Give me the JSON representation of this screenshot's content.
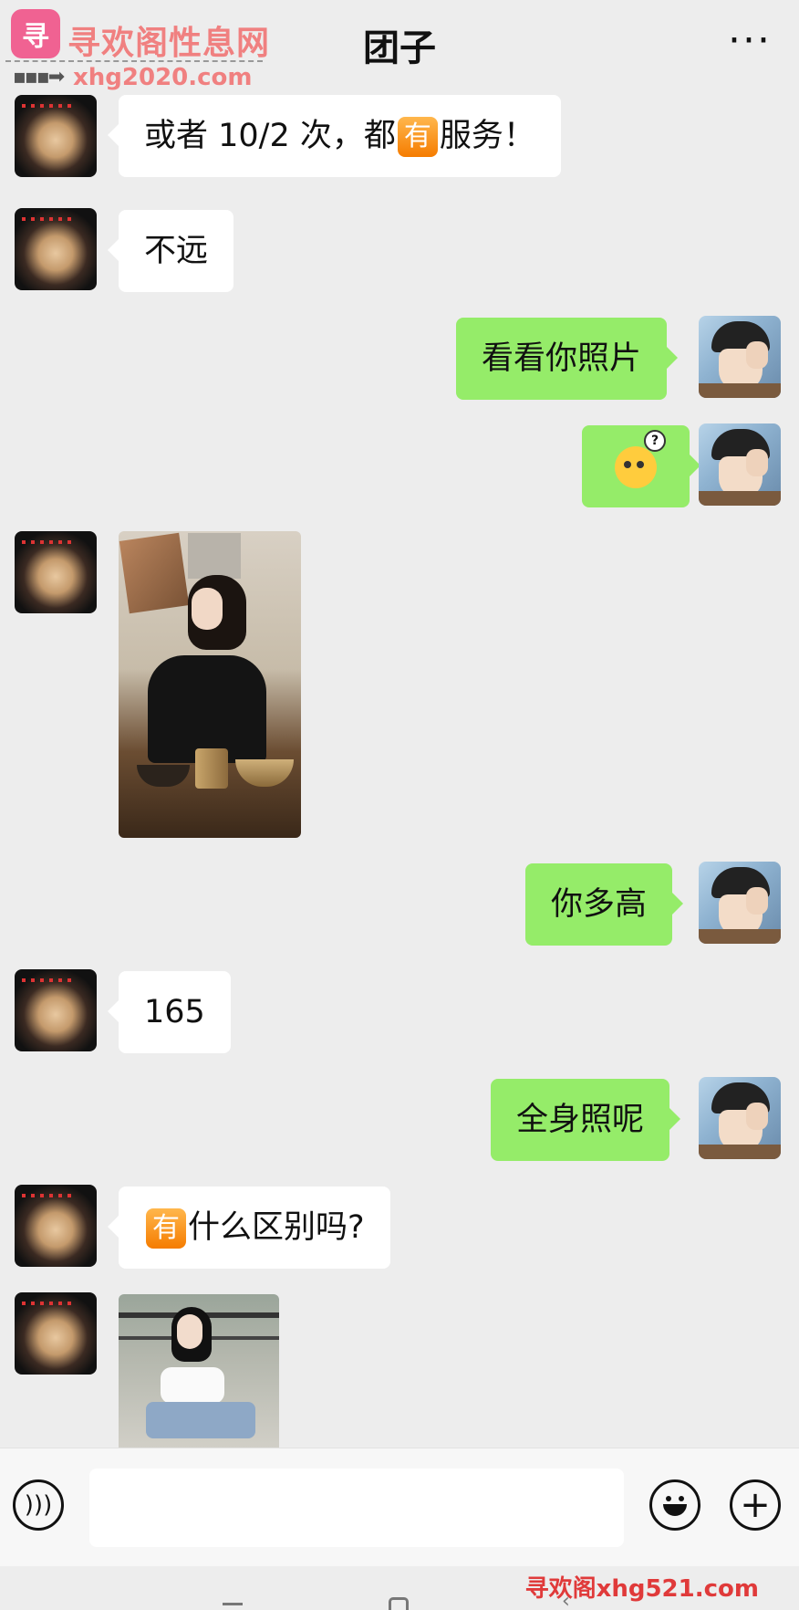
{
  "header": {
    "title": "团子",
    "back_glyph": "‹",
    "more_glyph": "···"
  },
  "watermark": {
    "logo_char": "寻",
    "site_name": "寻欢阁性息网",
    "site_url": "xhg2020.com",
    "arrow": "▪▪▪➡",
    "bottom": "寻欢阁xhg521.com"
  },
  "messages": [
    {
      "side": "left",
      "type": "text",
      "parts": [
        "或者 10/2 次，都",
        "有",
        "服务！"
      ]
    },
    {
      "side": "left",
      "type": "text",
      "text": "不远"
    },
    {
      "side": "right",
      "type": "text",
      "text": "看看你照片"
    },
    {
      "side": "right",
      "type": "emoji",
      "icon": "confused-face-emoji"
    },
    {
      "side": "left",
      "type": "image",
      "desc": "photo-woman-black-top"
    },
    {
      "side": "right",
      "type": "text",
      "text": "你多高"
    },
    {
      "side": "left",
      "type": "text",
      "text": "165"
    },
    {
      "side": "right",
      "type": "text",
      "text": "全身照呢"
    },
    {
      "side": "left",
      "type": "text",
      "parts": [
        "有",
        "什么区别吗?"
      ]
    },
    {
      "side": "left",
      "type": "image",
      "desc": "photo-woman-white-top"
    }
  ],
  "input": {
    "value": "",
    "voice_icon": "voice-icon",
    "emoji_icon": "emoji-icon",
    "plus_icon": "plus-icon",
    "plus_glyph": "+"
  },
  "colors": {
    "background": "#ededed",
    "bubble_left": "#ffffff",
    "bubble_right": "#95ec69"
  }
}
